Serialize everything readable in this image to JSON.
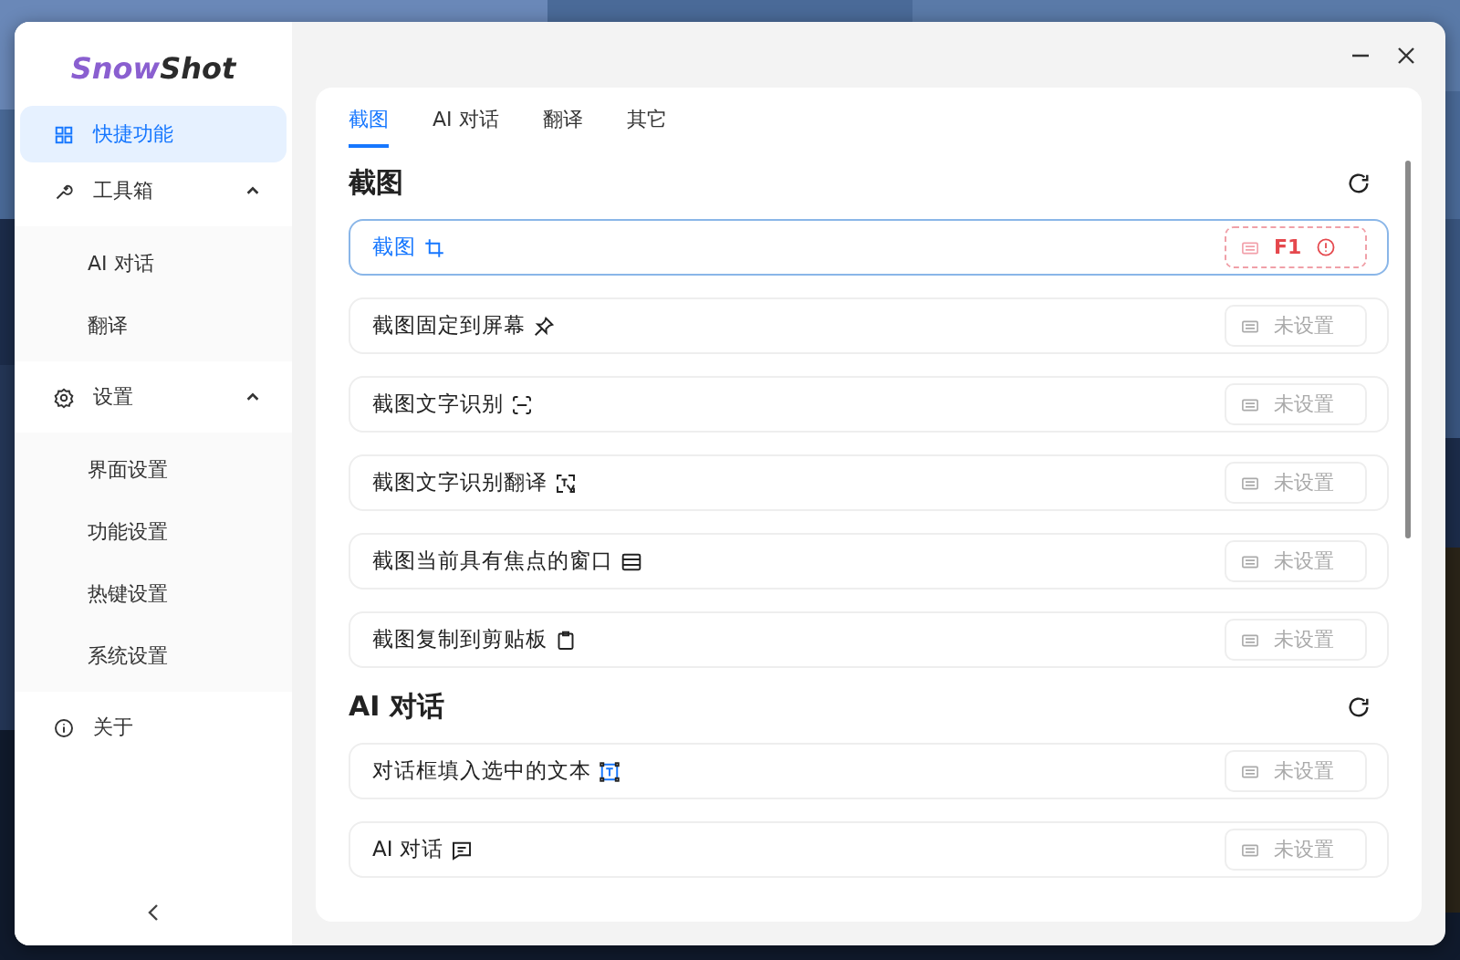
{
  "sidebar": {
    "logo": {
      "first": "Snow",
      "second": "Shot"
    },
    "items": [
      {
        "kind": "shortcut",
        "label": "快捷功能",
        "selected": true
      },
      {
        "kind": "tools",
        "label": "工具箱",
        "selected": false,
        "expanded": true,
        "children": [
          {
            "label": "AI 对话",
            "selected": false
          },
          {
            "label": "翻译",
            "selected": false
          }
        ]
      },
      {
        "kind": "settings",
        "label": "设置",
        "selected": false,
        "expanded": true,
        "children": [
          {
            "label": "界面设置",
            "selected": false
          },
          {
            "label": "功能设置",
            "selected": false
          },
          {
            "label": "热键设置",
            "selected": false
          },
          {
            "label": "系统设置",
            "selected": false
          }
        ]
      },
      {
        "kind": "about",
        "label": "关于",
        "selected": false
      }
    ]
  },
  "tabs": [
    {
      "label": "截图",
      "selected": true
    },
    {
      "label": "AI 对话",
      "selected": false
    },
    {
      "label": "翻译",
      "selected": false
    },
    {
      "label": "其它",
      "selected": false
    }
  ],
  "sections": [
    {
      "title": "截图",
      "rows": [
        {
          "label": "截图",
          "selected": true,
          "hotkey": {
            "value": "F1",
            "conflict": true
          }
        },
        {
          "label": "截图固定到屏幕",
          "selected": false,
          "hotkey": {
            "placeholder": "未设置",
            "conflict": false
          }
        },
        {
          "label": "截图文字识别",
          "selected": false,
          "hotkey": {
            "placeholder": "未设置",
            "conflict": false
          }
        },
        {
          "label": "截图文字识别翻译",
          "selected": false,
          "hotkey": {
            "placeholder": "未设置",
            "conflict": false
          }
        },
        {
          "label": "截图当前具有焦点的窗口",
          "selected": false,
          "hotkey": {
            "placeholder": "未设置",
            "conflict": false
          }
        },
        {
          "label": "截图复制到剪贴板",
          "selected": false,
          "hotkey": {
            "placeholder": "未设置",
            "conflict": false
          }
        }
      ]
    },
    {
      "title": "AI 对话",
      "rows": [
        {
          "label": "对话框填入选中的文本",
          "selected": false,
          "hotkey": {
            "placeholder": "未设置",
            "conflict": false
          }
        },
        {
          "label": "AI 对话",
          "selected": false,
          "hotkey": {
            "placeholder": "未设置",
            "conflict": false
          }
        }
      ]
    }
  ]
}
